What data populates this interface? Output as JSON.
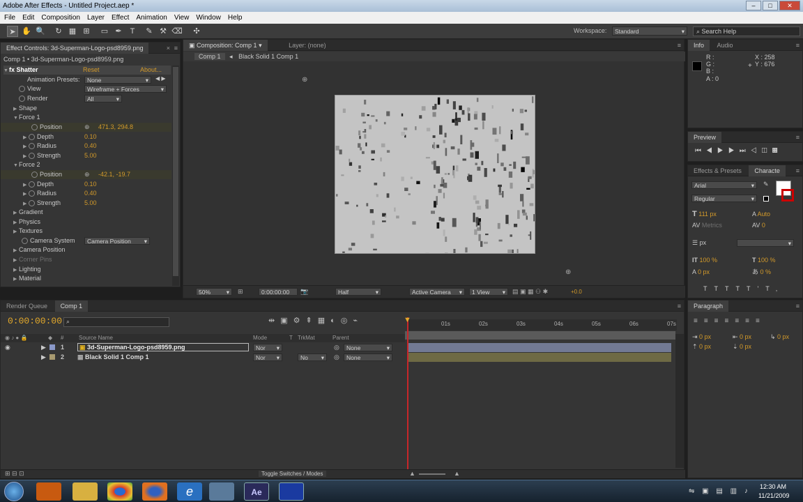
{
  "window": {
    "title": "Adobe After Effects - Untitled Project.aep *",
    "min": "–",
    "max": "□",
    "close": "✕"
  },
  "menu": [
    "File",
    "Edit",
    "Composition",
    "Layer",
    "Effect",
    "Animation",
    "View",
    "Window",
    "Help"
  ],
  "toolbar": {
    "workspace_label": "Workspace:",
    "workspace_value": "Standard",
    "search_placeholder": "Search Help"
  },
  "effect_controls": {
    "tab": "Effect Controls: 3d-Superman-Logo-psd8959.png",
    "breadcrumb": "Comp 1 • 3d-Superman-Logo-psd8959.png",
    "effect_name": "Shatter",
    "reset": "Reset",
    "about": "About...",
    "animation_presets_label": "Animation Presets:",
    "animation_presets_value": "None",
    "view_label": "View",
    "view_value": "Wireframe + Forces",
    "render_label": "Render",
    "render_value": "All",
    "shape": "Shape",
    "force1": {
      "label": "Force 1",
      "position_label": "Position",
      "position": "471.3, 294.8",
      "depth_label": "Depth",
      "depth": "0.10",
      "radius_label": "Radius",
      "radius": "0.40",
      "strength_label": "Strength",
      "strength": "5.00"
    },
    "force2": {
      "label": "Force 2",
      "position_label": "Position",
      "position": "-42.1, -19.7",
      "depth_label": "Depth",
      "depth": "0.10",
      "radius_label": "Radius",
      "radius": "0.40",
      "strength_label": "Strength",
      "strength": "5.00"
    },
    "gradient": "Gradient",
    "physics": "Physics",
    "textures": "Textures",
    "camera_system_label": "Camera System",
    "camera_system_value": "Camera Position",
    "camera_position": "Camera Position",
    "corner_pins": "Corner Pins",
    "lighting": "Lighting",
    "material": "Material"
  },
  "composition": {
    "tab": "Composition: Comp 1",
    "layer_tab": "Layer: (none)",
    "crumb1": "Comp 1",
    "crumb2": "Black Solid 1 Comp 1",
    "zoom": "50%",
    "timecode": "0:00:00:00",
    "resolution": "Half",
    "camera": "Active Camera",
    "views": "1 View",
    "exposure": "+0.0"
  },
  "info": {
    "tab": "Info",
    "audio_tab": "Audio",
    "r": "R :",
    "g": "G :",
    "b": "B :",
    "a": "A : 0",
    "x": "X : 258",
    "y": "Y : 676"
  },
  "preview": {
    "tab": "Preview"
  },
  "effects_presets": {
    "tab": "Effects & Presets",
    "character_tab": "Characte"
  },
  "character": {
    "font": "Arial",
    "style": "Regular",
    "size": "111 px",
    "leading": "Auto",
    "kerning": "Metrics",
    "tracking": "0",
    "stroke_unit": "px",
    "vscale": "100 %",
    "hscale": "100 %",
    "baseline": "0 px",
    "tsume": "0 %"
  },
  "paragraph": {
    "tab": "Paragraph",
    "indent1": "0 px",
    "indent2": "0 px",
    "indent3": "0 px",
    "space1": "0 px",
    "space2": "0 px"
  },
  "timeline": {
    "render_queue_tab": "Render Queue",
    "comp_tab": "Comp 1",
    "timecode": "0:00:00:00",
    "col_source": "Source Name",
    "col_mode": "Mode",
    "col_t": "T",
    "col_trkmat": "TrkMat",
    "col_parent": "Parent",
    "ticks": [
      "01s",
      "02s",
      "03s",
      "04s",
      "05s",
      "06s",
      "07s"
    ],
    "layers": [
      {
        "num": "1",
        "name": "3d-Superman-Logo-psd8959.png",
        "mode": "Nor",
        "trkmat": "",
        "parent": "None"
      },
      {
        "num": "2",
        "name": "Black Solid 1 Comp 1",
        "mode": "Nor",
        "trkmat": "No",
        "parent": "None"
      }
    ],
    "toggle": "Toggle Switches / Modes"
  },
  "taskbar": {
    "time": "12:30 AM",
    "date": "11/21/2009"
  }
}
